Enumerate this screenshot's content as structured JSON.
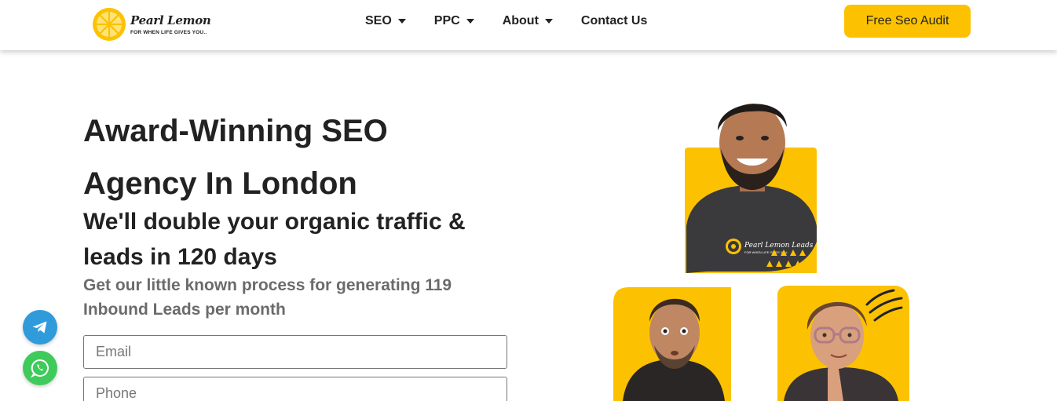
{
  "header": {
    "logo": {
      "name": "Pearl Lemon",
      "tagline": "FOR WHEN LIFE GIVES YOU.."
    },
    "nav": [
      {
        "label": "SEO",
        "has_dropdown": true
      },
      {
        "label": "PPC",
        "has_dropdown": true
      },
      {
        "label": "About",
        "has_dropdown": true
      },
      {
        "label": "Contact Us",
        "has_dropdown": false
      }
    ],
    "cta_label": "Free Seo Audit"
  },
  "hero": {
    "title_line1": "Award-Winning SEO",
    "title_line2": "Agency In London",
    "subtitle_line1": "We'll double your organic traffic &",
    "subtitle_line2": "leads in 120 days",
    "description_line1": "Get our little known process for generating 119",
    "description_line2": "Inbound Leads per month",
    "form": {
      "email_placeholder": "Email",
      "phone_placeholder": "Phone"
    }
  },
  "photos": {
    "shirt_text": "Pearl Lemon Leads",
    "shirt_tagline": "FOR WHEN LIFE GIVES YOU.."
  },
  "colors": {
    "accent": "#fcc201",
    "telegram": "#2f9bdb",
    "whatsapp": "#3fcb5b",
    "text_dark": "#222222",
    "text_muted": "#6b6b6b"
  },
  "icons": [
    "lemon-logo-icon",
    "caret-down-icon",
    "telegram-icon",
    "whatsapp-icon"
  ]
}
